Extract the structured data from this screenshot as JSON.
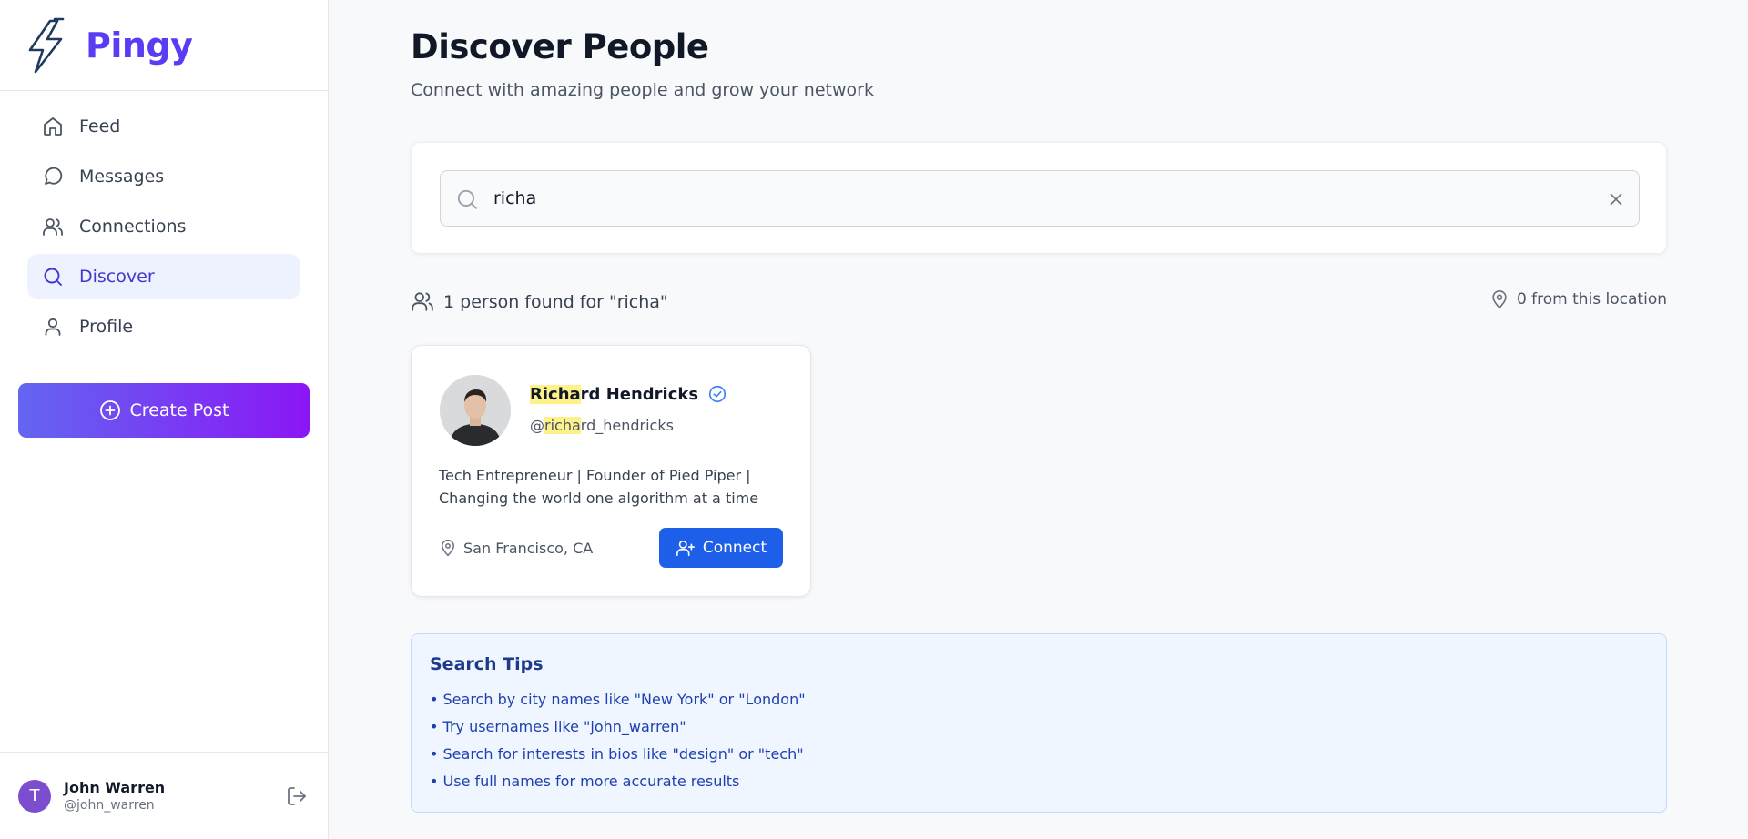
{
  "app": {
    "name": "Pingy",
    "brand_color": "#5b3cf5"
  },
  "sidebar": {
    "items": [
      {
        "label": "Feed",
        "icon": "home-icon"
      },
      {
        "label": "Messages",
        "icon": "message-circle-icon"
      },
      {
        "label": "Connections",
        "icon": "users-icon"
      },
      {
        "label": "Discover",
        "icon": "search-icon",
        "active": true
      },
      {
        "label": "Profile",
        "icon": "user-icon"
      }
    ],
    "create_post_label": "Create Post",
    "user": {
      "initial": "T",
      "name": "John Warren",
      "handle": "@john_warren"
    }
  },
  "main": {
    "title": "Discover People",
    "subtitle": "Connect with amazing people and grow your network",
    "search": {
      "value": "richa"
    },
    "results": {
      "summary": "1 person found for \"richa\"",
      "location_count": "0 from this location"
    },
    "people": [
      {
        "name_highlight": "Richa",
        "name_rest": "rd Hendricks",
        "handle_prefix": "@",
        "handle_highlight": "richa",
        "handle_rest": "rd_hendricks",
        "verified": true,
        "bio": "Tech Entrepreneur | Founder of Pied Piper | Changing the world one algorithm at a time",
        "location": "San Francisco, CA",
        "connect_label": "Connect"
      }
    ],
    "tips": {
      "title": "Search Tips",
      "items": [
        "• Search by city names like \"New York\" or \"London\"",
        "• Try usernames like \"john_warren\"",
        "• Search for interests in bios like \"design\" or \"tech\"",
        "• Use full names for more accurate results"
      ]
    }
  },
  "colors": {
    "primary_button": "#1d5fe8",
    "highlight": "#fdf18a",
    "active_nav_bg": "#eef2ff"
  }
}
